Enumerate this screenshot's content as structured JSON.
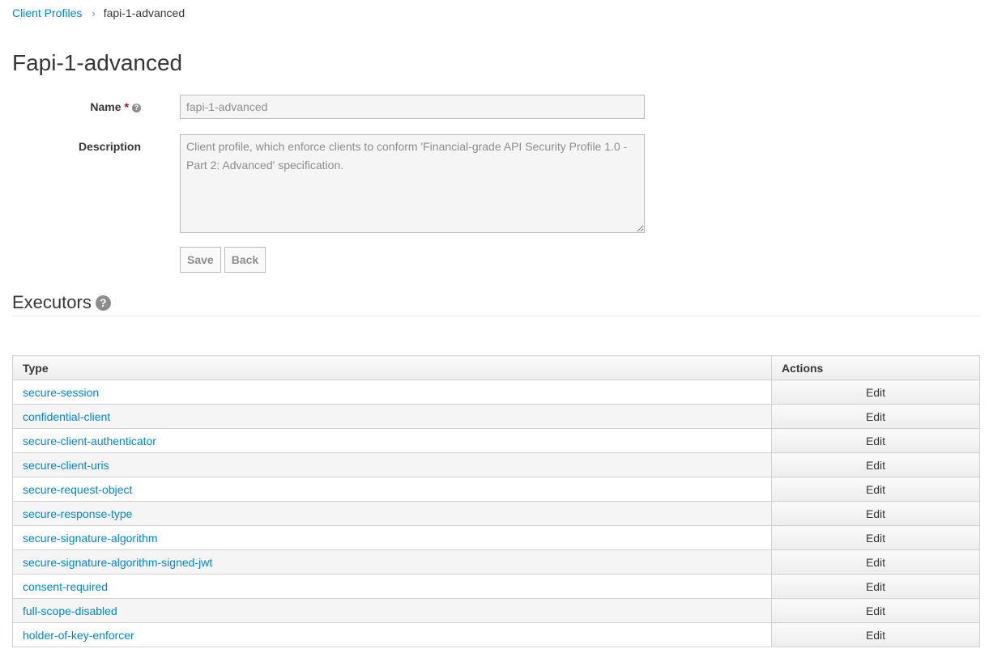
{
  "breadcrumb": {
    "parent": "Client Profiles",
    "separator": "›",
    "current": "fapi-1-advanced"
  },
  "page": {
    "title": "Fapi-1-advanced"
  },
  "form": {
    "name_label": "Name",
    "name_required": "*",
    "name_help_icon": "?",
    "name_value": "fapi-1-advanced",
    "description_label": "Description",
    "description_value": "Client profile, which enforce clients to conform 'Financial-grade API Security Profile 1.0 - Part 2: Advanced' specification.",
    "save_label": "Save",
    "back_label": "Back"
  },
  "executors": {
    "title": "Executors",
    "help_icon": "?",
    "columns": {
      "type": "Type",
      "actions": "Actions"
    },
    "edit_label": "Edit",
    "rows": [
      {
        "type": "secure-session"
      },
      {
        "type": "confidential-client"
      },
      {
        "type": "secure-client-authenticator"
      },
      {
        "type": "secure-client-uris"
      },
      {
        "type": "secure-request-object"
      },
      {
        "type": "secure-response-type"
      },
      {
        "type": "secure-signature-algorithm"
      },
      {
        "type": "secure-signature-algorithm-signed-jwt"
      },
      {
        "type": "consent-required"
      },
      {
        "type": "full-scope-disabled"
      },
      {
        "type": "holder-of-key-enforcer"
      }
    ]
  },
  "colors": {
    "link": "#0088ce",
    "required": "#cc0000"
  }
}
